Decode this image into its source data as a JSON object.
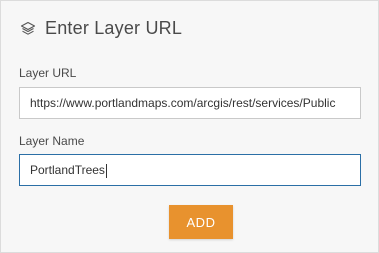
{
  "dialog": {
    "title": "Enter Layer URL",
    "icon": "layers-icon"
  },
  "form": {
    "url_label": "Layer URL",
    "url_value": "https://www.portlandmaps.com/arcgis/rest/services/Public",
    "name_label": "Layer Name",
    "name_value": "PortlandTrees"
  },
  "actions": {
    "add_label": "ADD"
  },
  "colors": {
    "accent": "#e8922e",
    "focus_border": "#2b6fa6"
  }
}
